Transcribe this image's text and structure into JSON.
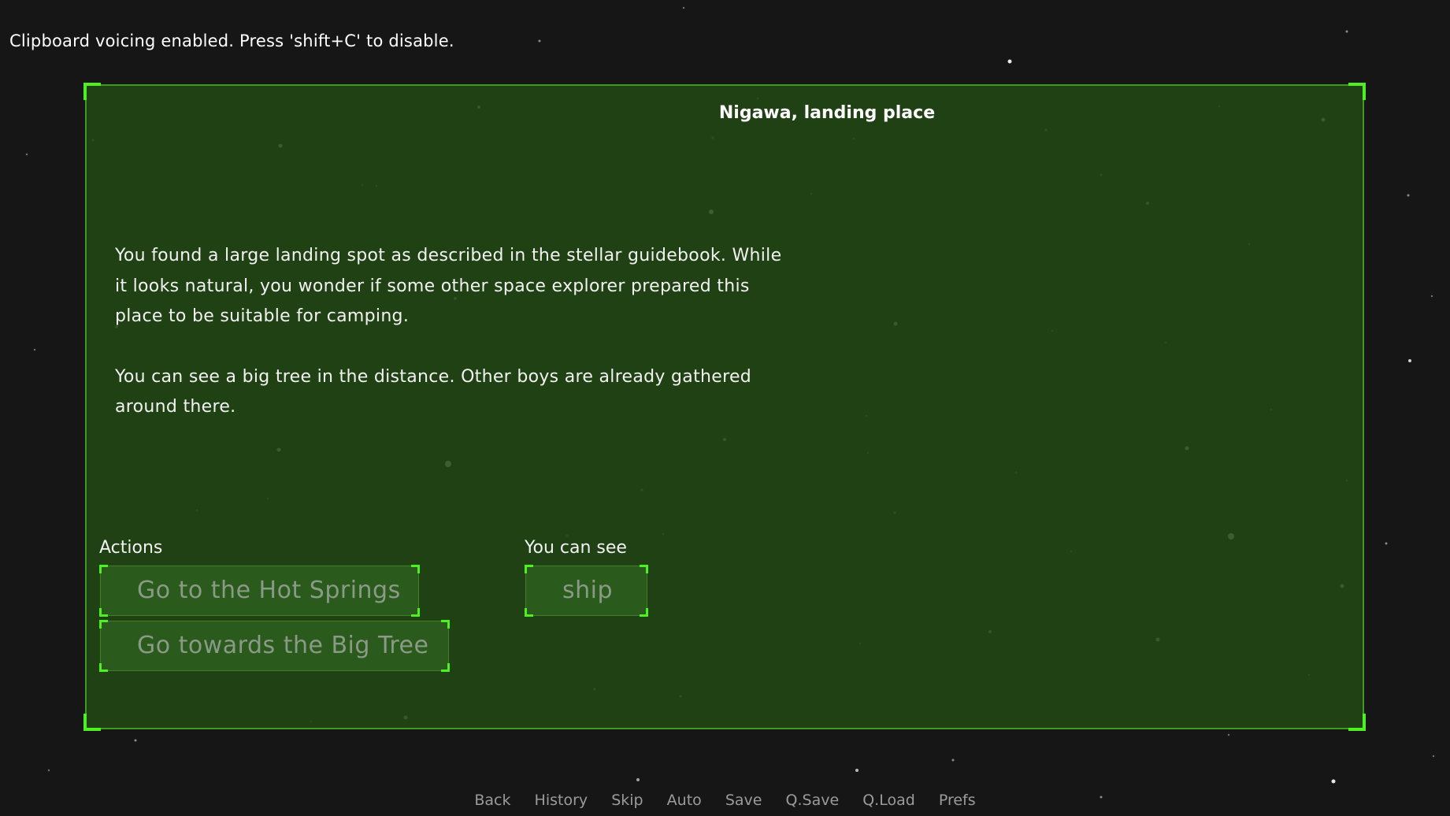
{
  "notice": {
    "text": "Clipboard voicing enabled. Press 'shift+C' to disable."
  },
  "location": {
    "title": "Nigawa, landing place",
    "description": [
      "You found a large landing spot as described in the stellar guidebook. While it looks natural, you wonder if some other space explorer prepared this place to be suitable for camping.",
      "You can see a big tree in the distance. Other boys are already gathered around there."
    ]
  },
  "actions": {
    "label": "Actions",
    "items": [
      "Go to the Hot Springs",
      "Go towards the Big Tree"
    ]
  },
  "visible": {
    "label": "You can see",
    "items": [
      "ship"
    ]
  },
  "quickmenu": {
    "items": [
      "Back",
      "History",
      "Skip",
      "Auto",
      "Save",
      "Q.Save",
      "Q.Load",
      "Prefs"
    ]
  },
  "colors": {
    "background": "#161616",
    "panel": "#22481a",
    "panel_border": "#3f9a22",
    "corner_accent": "#4ff01f",
    "button": "#2a5a1c",
    "button_text": "#8a9a86",
    "quickmenu_text": "#9b9b9b"
  }
}
